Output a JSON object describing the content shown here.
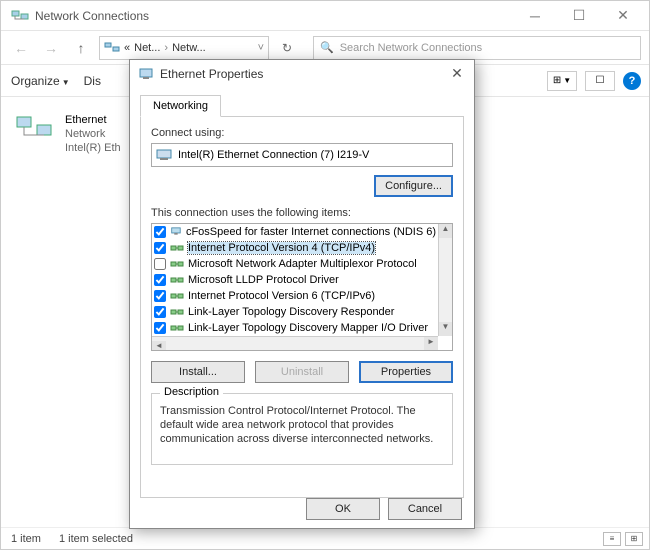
{
  "window": {
    "title": "Network Connections",
    "breadcrumb": {
      "part1": "Net...",
      "part2": "Netw..."
    },
    "search_placeholder": "Search Network Connections"
  },
  "toolbar": {
    "organize": "Organize",
    "disable": "Dis",
    "view1": "⊞",
    "view2": "☐",
    "help": "?"
  },
  "connection": {
    "name": "Ethernet",
    "sub1": "Network",
    "sub2": "Intel(R) Eth"
  },
  "statusbar": {
    "count": "1 item",
    "selected": "1 item selected"
  },
  "dialog": {
    "title": "Ethernet Properties",
    "tab": "Networking",
    "connect_using": "Connect using:",
    "adapter": "Intel(R) Ethernet Connection (7) I219-V",
    "configure": "Configure...",
    "items_label": "This connection uses the following items:",
    "items": [
      {
        "checked": true,
        "label": "cFosSpeed for faster Internet connections (NDIS 6)",
        "selected": false,
        "icon": "monitor"
      },
      {
        "checked": true,
        "label": "Internet Protocol Version 4 (TCP/IPv4)",
        "selected": true,
        "icon": "net"
      },
      {
        "checked": false,
        "label": "Microsoft Network Adapter Multiplexor Protocol",
        "selected": false,
        "icon": "net"
      },
      {
        "checked": true,
        "label": "Microsoft LLDP Protocol Driver",
        "selected": false,
        "icon": "net"
      },
      {
        "checked": true,
        "label": "Internet Protocol Version 6 (TCP/IPv6)",
        "selected": false,
        "icon": "net"
      },
      {
        "checked": true,
        "label": "Link-Layer Topology Discovery Responder",
        "selected": false,
        "icon": "net"
      },
      {
        "checked": true,
        "label": "Link-Layer Topology Discovery Mapper I/O Driver",
        "selected": false,
        "icon": "net"
      }
    ],
    "install": "Install...",
    "uninstall": "Uninstall",
    "properties": "Properties",
    "desc_legend": "Description",
    "desc_text": "Transmission Control Protocol/Internet Protocol. The default wide area network protocol that provides communication across diverse interconnected networks.",
    "ok": "OK",
    "cancel": "Cancel"
  }
}
